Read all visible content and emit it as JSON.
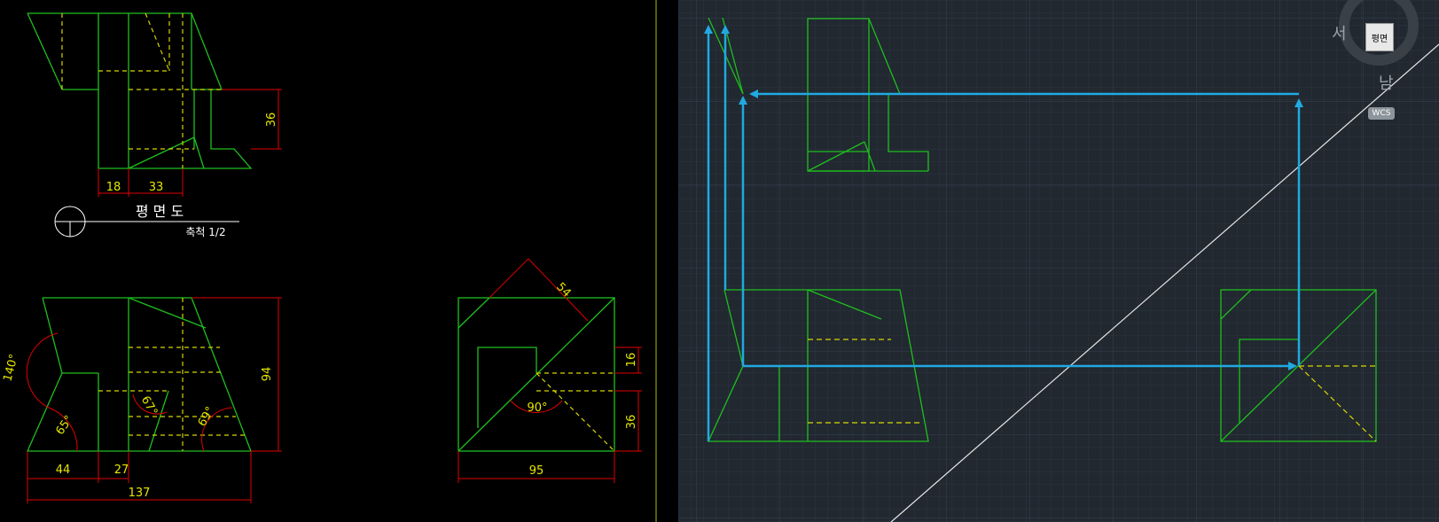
{
  "paper": {
    "plan_dims": {
      "d36": "36",
      "d18": "18",
      "d33": "33"
    },
    "title_block": {
      "title": "평 면 도",
      "scale": "축척 1/2"
    },
    "front_dims": {
      "d44": "44",
      "d27": "27",
      "d137": "137",
      "d94": "94",
      "a140": "140°",
      "a65": "65°",
      "a67": "67°",
      "a69": "69°"
    },
    "side_dims": {
      "d54": "54",
      "d16": "16",
      "d36": "36",
      "d95": "95",
      "a90": "90°"
    }
  },
  "model": {
    "viewcube": {
      "face_label": "평면",
      "west": "서",
      "south": "남",
      "wcs": "WCS"
    }
  },
  "colors": {
    "geometry": "#1fbf1f",
    "hidden": "#d6d600",
    "dimension": "#e00000",
    "text": "#e6e600",
    "arrow": "#21a9e1",
    "background_model": "#212830"
  }
}
